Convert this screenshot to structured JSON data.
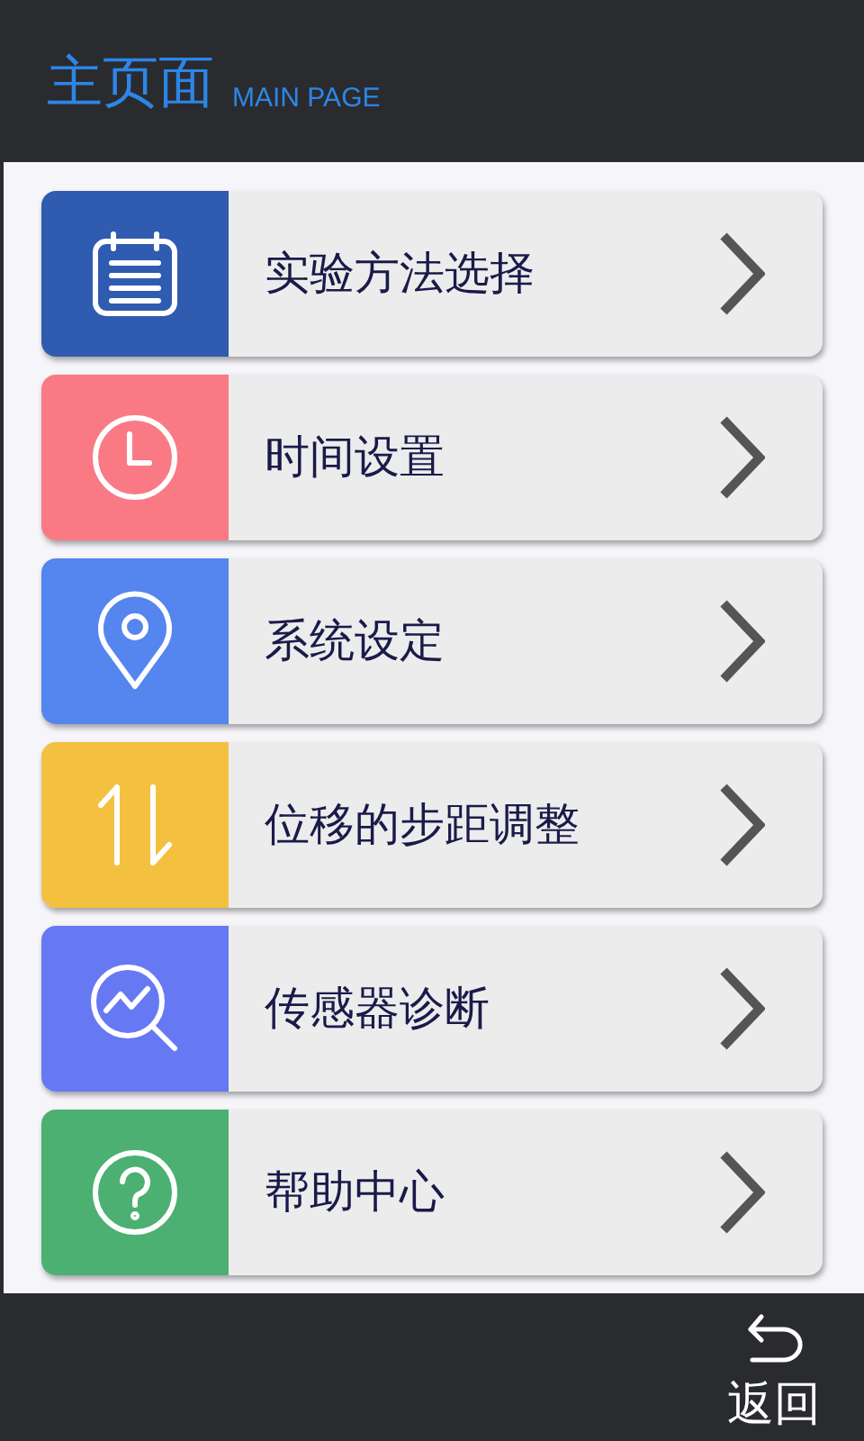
{
  "header": {
    "title": "主页面",
    "subtitle": "MAIN PAGE"
  },
  "menu": [
    {
      "label": "实验方法选择",
      "color": "#2f5bb0"
    },
    {
      "label": "时间设置",
      "color": "#f97a85"
    },
    {
      "label": "系统设定",
      "color": "#5585ee"
    },
    {
      "label": "位移的步距调整",
      "color": "#f4c040"
    },
    {
      "label": "传感器诊断",
      "color": "#6779f2"
    },
    {
      "label": "帮助中心",
      "color": "#4bb072"
    }
  ],
  "footer": {
    "back_label": "返回"
  }
}
